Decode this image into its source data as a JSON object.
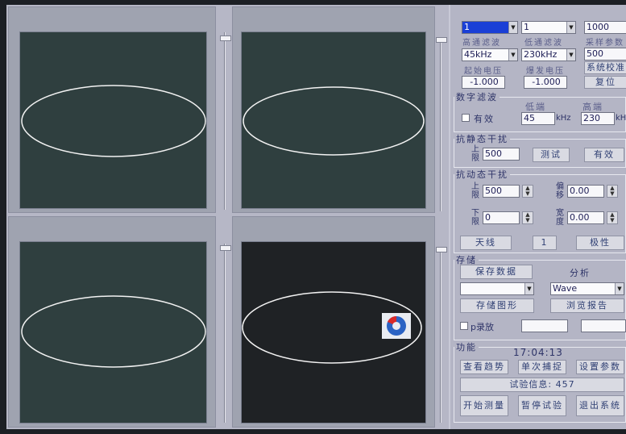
{
  "top_controls": {
    "combo_1": "1",
    "combo_2": "1",
    "field_3": "1000",
    "highpass_label": "高通滤波",
    "lowpass_label": "低通滤波",
    "sample_label": "采样参数",
    "highpass_value": "45kHz",
    "lowpass_value": "230kHz",
    "field_500": "500",
    "calib_button": "系统校准",
    "start_voltage_label": "起始电压",
    "burst_voltage_label": "爆发电压",
    "start_voltage": "-1.000",
    "burst_voltage": "-1.000",
    "reset_button": "复位"
  },
  "digital_filter": {
    "title": "数字滤波",
    "enable_label": "有效",
    "low_label": "低端",
    "high_label": "高端",
    "low_value": "45",
    "high_value": "230",
    "unit_khz": "kHz",
    "unit_khz2": "kHz"
  },
  "static_interference": {
    "title": "抗静态干扰",
    "upper_label": "上限",
    "upper_value": "500",
    "test_button": "测试",
    "valid_button": "有效"
  },
  "dynamic_interference": {
    "title": "抗动态干扰",
    "upper_label": "上限",
    "upper_value": "500",
    "offset_label": "偏移",
    "offset_value": "0.00",
    "lower_label": "下限",
    "lower_value": "0",
    "width_label": "宽度",
    "width_value": "0.00",
    "antenna_button": "天线",
    "number_button": "1",
    "polarity_button": "极性"
  },
  "storage": {
    "title": "存储",
    "save_data_button": "保存数据",
    "analysis_label": "分析",
    "combo_left": "",
    "combo_wave": "Wave",
    "save_graph_button": "存储图形",
    "browse_report_button": "浏览报告",
    "playback_label": "p录放"
  },
  "functions": {
    "title": "功能",
    "time": "17:04:13",
    "view_trend_button": "查看趋势",
    "single_acq_button": "单次捕捉",
    "set_params_button": "设置参数",
    "test_info": "试验信息: 457",
    "start_measure_button": "开始测量",
    "pause_test_button": "暂停试验",
    "exit_system_button": "退出系统"
  },
  "colors": {
    "plot_bg": "#2f3f3f",
    "plot_bg_dark": "#1f2225",
    "trace": "#f2f2f2",
    "selected_combo": "#1a3fd6"
  }
}
